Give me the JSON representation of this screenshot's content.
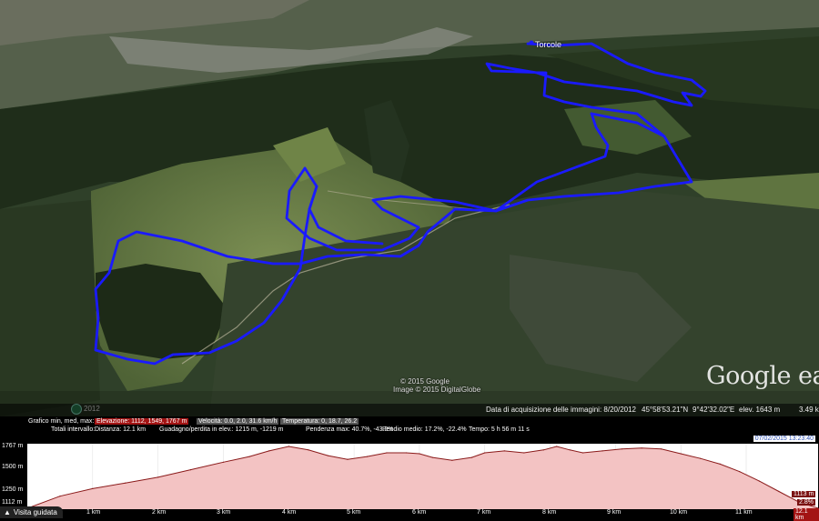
{
  "map": {
    "place_label": "Torcole",
    "copyright_google": "© 2015 Google",
    "copyright_imagery": "Image © 2015 DigitalGlobe",
    "logo": "Google earth",
    "track_color": "#1a1aff",
    "history_year": "2012"
  },
  "status": {
    "imagery_date": "Data di acquisizione delle immagini: 8/20/2012",
    "lat": "45°58'53.21\"N",
    "lon": "9°42'32.02\"E",
    "elev": "elev. 1643 m",
    "eye": "3.49 k"
  },
  "profile_panel": {
    "row1": {
      "grafico": "Grafico min, med, max:",
      "elevazione": "Elevazione: 1112, 1549, 1767 m",
      "velocita": "Velocità: 0.0, 2.0, 31.6 km/h",
      "temperatura": "Temperatura: 0, 18.7, 26.2"
    },
    "row2": {
      "totali": "Totali intervallo:",
      "distanza": "Distanza: 12.1 km",
      "guadagno": "Guadagno/perdita in elev.: 1215 m, -1219 m",
      "pendenza": "Pendenza max: 40.7%, -43.2%",
      "pendio": "Pendio medio: 17.2%, -22.4%",
      "tempo": "Tempo: 5 h 56 m 11 s"
    },
    "date_badge": "07/02/2015 13:23:40",
    "y_ticks": [
      "1767 m",
      "1500 m",
      "1250 m",
      "1112 m"
    ],
    "x_ticks": [
      "1 km",
      "2 km",
      "3 km",
      "4 km",
      "5 km",
      "6 km",
      "7 km",
      "8 km",
      "9 km",
      "10 km",
      "11 km"
    ],
    "cursor_elev": "1113 m",
    "cursor_grade": "2.8%",
    "cursor_dist": "12.1 km",
    "tour_button": "Visita guidata",
    "fill_color": "#f3c3c3",
    "line_color": "#8a1a1a"
  },
  "chart_data": {
    "type": "area",
    "xlabel": "",
    "ylabel": "",
    "xlim": [
      0,
      12.1
    ],
    "ylim": [
      1112,
      1767
    ],
    "x": [
      0,
      0.5,
      1.0,
      1.5,
      2.0,
      2.5,
      3.0,
      3.4,
      3.7,
      4.0,
      4.3,
      4.6,
      4.9,
      5.2,
      5.5,
      5.8,
      6.0,
      6.2,
      6.5,
      6.8,
      7.0,
      7.3,
      7.6,
      7.9,
      8.1,
      8.3,
      8.5,
      8.8,
      9.1,
      9.4,
      9.7,
      10.0,
      10.3,
      10.6,
      10.9,
      11.2,
      11.5,
      11.8,
      12.1
    ],
    "y": [
      1112,
      1240,
      1320,
      1380,
      1440,
      1520,
      1600,
      1660,
      1720,
      1767,
      1730,
      1670,
      1630,
      1660,
      1700,
      1700,
      1690,
      1650,
      1620,
      1650,
      1700,
      1720,
      1700,
      1730,
      1767,
      1730,
      1700,
      1720,
      1740,
      1750,
      1740,
      1690,
      1640,
      1580,
      1500,
      1400,
      1290,
      1180,
      1113
    ]
  }
}
